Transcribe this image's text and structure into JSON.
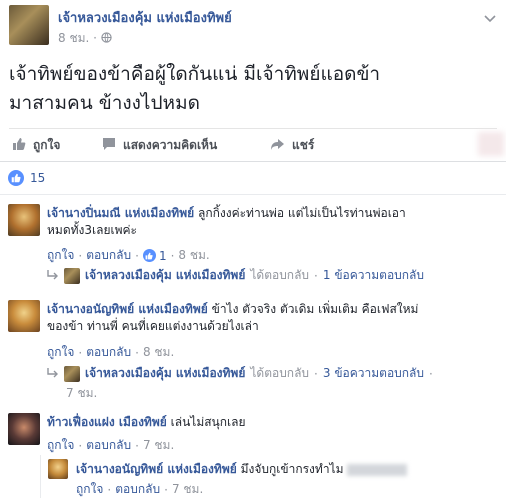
{
  "post": {
    "author": "เจ้าหลวงเมืองคุ้ม แห่งเมืองทิพย์",
    "time": "8 ชม.",
    "text_line1": "เจ้าทิพย์ของข้าคือผู้ใดกันแน่ มีเจ้าทิพย์แอดข้า",
    "text_line2": "มาสามคน ข้างงไปหมด"
  },
  "actions": {
    "like": "ถูกใจ",
    "comment": "แสดงความคิดเห็น",
    "share": "แชร์"
  },
  "reactions": {
    "count": "15"
  },
  "comments": [
    {
      "author": "เจ้านางปิ่นมณี แห่งเมืองทิพย์",
      "text_line1": "ลูกกิ้งงค่ะท่านพ่อ แต่ไม่เป็นไรท่านพ่อเอา",
      "text_line2": "หมดทั้ง3เลยเพค่ะ",
      "like": "ถูกใจ",
      "reply": "ตอบกลับ",
      "likes": "1",
      "time": "8 ชม.",
      "reply_summary": {
        "author": "เจ้าหลวงเมืองคุ้ม แห่งเมืองทิพย์",
        "text": "ได้ตอบกลับ",
        "count": "1 ข้อความตอบกลับ"
      }
    },
    {
      "author": "เจ้านางอนัญทิพย์ แห่งเมืองทิพย์",
      "text_line1": "ข้าไง ตัวจริง ตัวเดิม เพิ่มเติม คือเฟสใหม่",
      "text_line2": "ของข้า ท่านพี่ คนที่เคยแต่งงานด้วยไงเล่า",
      "like": "ถูกใจ",
      "reply": "ตอบกลับ",
      "time": "8 ชม.",
      "reply_summary": {
        "author": "เจ้าหลวงเมืองคุ้ม แห่งเมืองทิพย์",
        "text": "ได้ตอบกลับ",
        "count": "3 ข้อความตอบกลับ",
        "time": "7 ชม."
      }
    },
    {
      "author": "ท้าวเฟื่องแฝง เมืองทิพย์",
      "text_line1": "เล่นไม่สนุกเลย",
      "like": "ถูกใจ",
      "reply": "ตอบกลับ",
      "time": "7 ชม."
    }
  ],
  "nested_reply": {
    "author": "เจ้านางอนัญทิพย์ แห่งเมืองทิพย์",
    "text": "มึงจับกูเข้ากรงทำไม",
    "like": "ถูกใจ",
    "reply": "ตอบกลับ",
    "time": "7 ชม."
  }
}
